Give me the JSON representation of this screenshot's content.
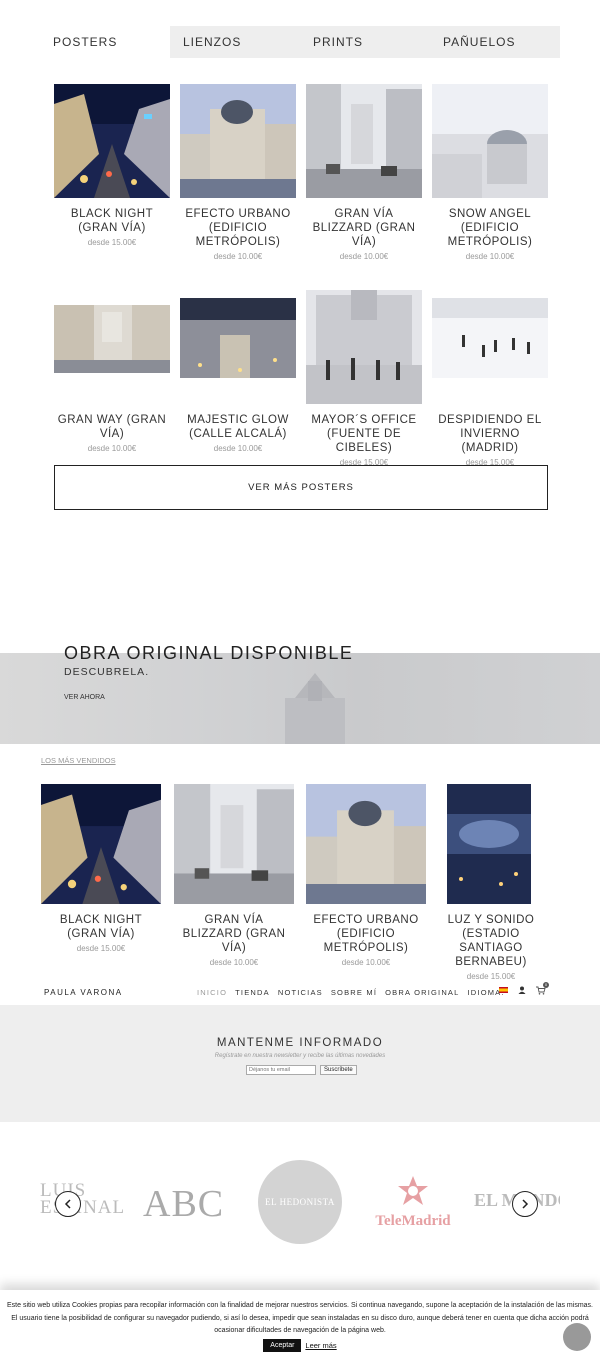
{
  "tabs": [
    "POSTERS",
    "LIENZOS",
    "PRINTS",
    "PAÑUELOS"
  ],
  "price_prefix": "desde",
  "posters_row1": [
    {
      "title": "BLACK NIGHT (GRAN VÍA)",
      "price": "15.00€"
    },
    {
      "title": "EFECTO URBANO (EDIFICIO METRÓPOLIS)",
      "price": "10.00€"
    },
    {
      "title": "GRAN VÍA BLIZZARD (GRAN VÍA)",
      "price": "10.00€"
    },
    {
      "title": "SNOW ANGEL (EDIFICIO METRÓPOLIS)",
      "price": "10.00€"
    }
  ],
  "posters_row2": [
    {
      "title": "GRAN WAY (GRAN VÍA)",
      "price": "10.00€"
    },
    {
      "title": "MAJESTIC GLOW (CALLE ALCALÁ)",
      "price": "10.00€"
    },
    {
      "title": "MAYOR´S OFFICE (FUENTE DE CIBELES)",
      "price": "15.00€"
    },
    {
      "title": "DESPIDIENDO EL INVIERNO (MADRID)",
      "price": "15.00€"
    }
  ],
  "more_button": "VER MÁS POSTERS",
  "banner": {
    "title": "OBRA ORIGINAL DISPONIBLE",
    "subtitle": "DESCUBRELA.",
    "link": "VER AHORA"
  },
  "best_sellers_label": "LOS MÁS VENDIDOS",
  "best_sellers": [
    {
      "title": "BLACK NIGHT (GRAN VÍA)",
      "price": "15.00€"
    },
    {
      "title": "GRAN VÍA BLIZZARD (GRAN VÍA)",
      "price": "10.00€"
    },
    {
      "title": "EFECTO URBANO (EDIFICIO METRÓPOLIS)",
      "price": "10.00€"
    },
    {
      "title": "LUZ Y SONIDO (ESTADIO SANTIAGO BERNABEU)",
      "price": "15.00€"
    }
  ],
  "nav": {
    "brand": "PAULA VARONA",
    "items": [
      "INICIO",
      "TIENDA",
      "NOTICIAS",
      "SOBRE MÍ",
      "OBRA ORIGINAL",
      "IDIOMA:"
    ],
    "cart_count": "0"
  },
  "newsletter": {
    "title": "MANTENME INFORMADO",
    "subtitle": "Regístrate en nuestra newsletter y recibe las últimas novedades",
    "placeholder": "Déjanos tu email",
    "button": "Suscríbete"
  },
  "press_logos": [
    "LUIS ESPINAL",
    "ABC",
    "EL HEDONISTA",
    "TeleMadrid",
    "EL MUNDO"
  ],
  "cookie": {
    "text": "Este sitio web utiliza Cookies propias para recopilar información con la finalidad de mejorar nuestros servicios. Si continua navegando, supone la aceptación de la instalación de las mismas. El usuario tiene la posibilidad de configurar su navegador pudiendo, si así lo desea, impedir que sean instaladas en su disco duro, aunque deberá tener en cuenta que dicha acción podrá ocasionar dificultades de navegación de la página web.",
    "accept": "Aceptar",
    "read_more": "Leer más"
  },
  "colors": {
    "text": "#333333",
    "muted": "#999999",
    "tab_bg": "#eeeeee"
  }
}
